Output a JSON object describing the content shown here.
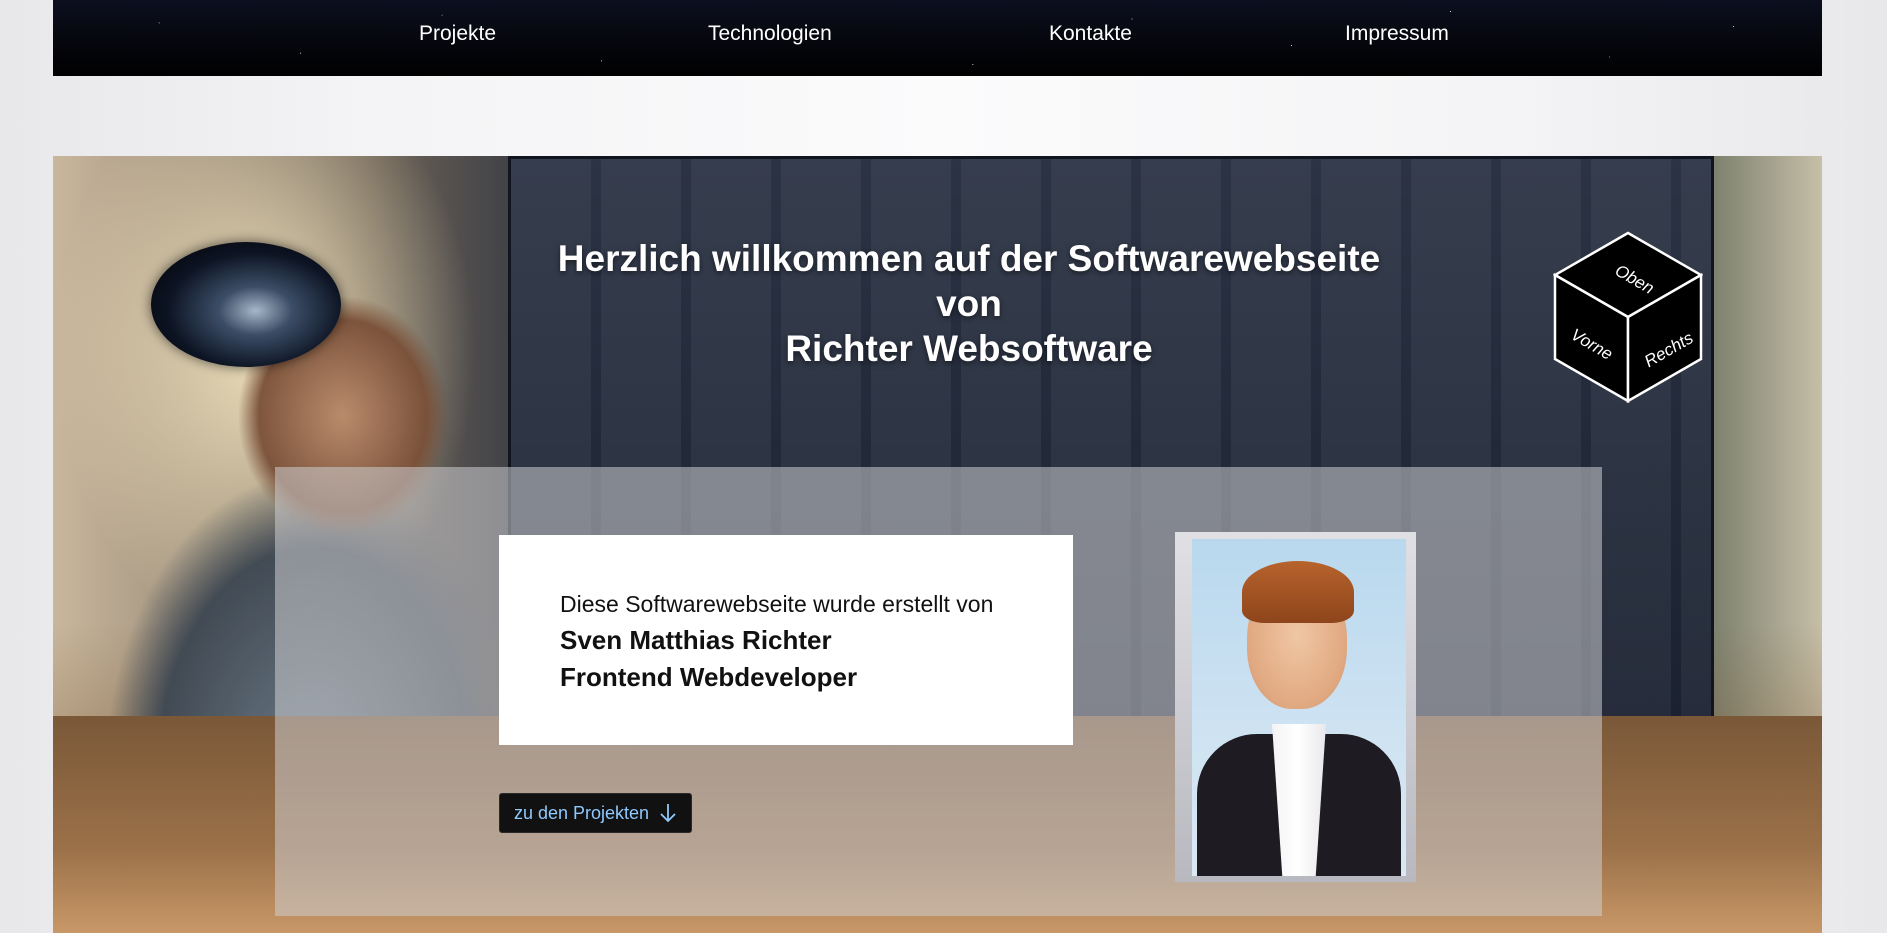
{
  "nav": {
    "items": [
      {
        "label": "Projekte"
      },
      {
        "label": "Technologien"
      },
      {
        "label": "Kontakte"
      },
      {
        "label": "Impressum"
      }
    ]
  },
  "hero": {
    "title_line1": "Herzlich willkommen auf der Softwarewebseite",
    "title_line2": "von",
    "title_line3": "Richter Websoftware",
    "cube_faces": {
      "top": "Oben",
      "front": "Vorne",
      "right": "Rechts"
    }
  },
  "info": {
    "line1": "Diese Softwarewebseite wurde erstellt von",
    "name": "Sven Matthias Richter",
    "role": "Frontend Webdeveloper"
  },
  "cta": {
    "label": "zu den Projekten",
    "icon": "arrow-down-icon"
  },
  "colors": {
    "nav_bg": "#000000",
    "cta_text": "#8ec9ff",
    "card_bg": "#ffffff"
  }
}
